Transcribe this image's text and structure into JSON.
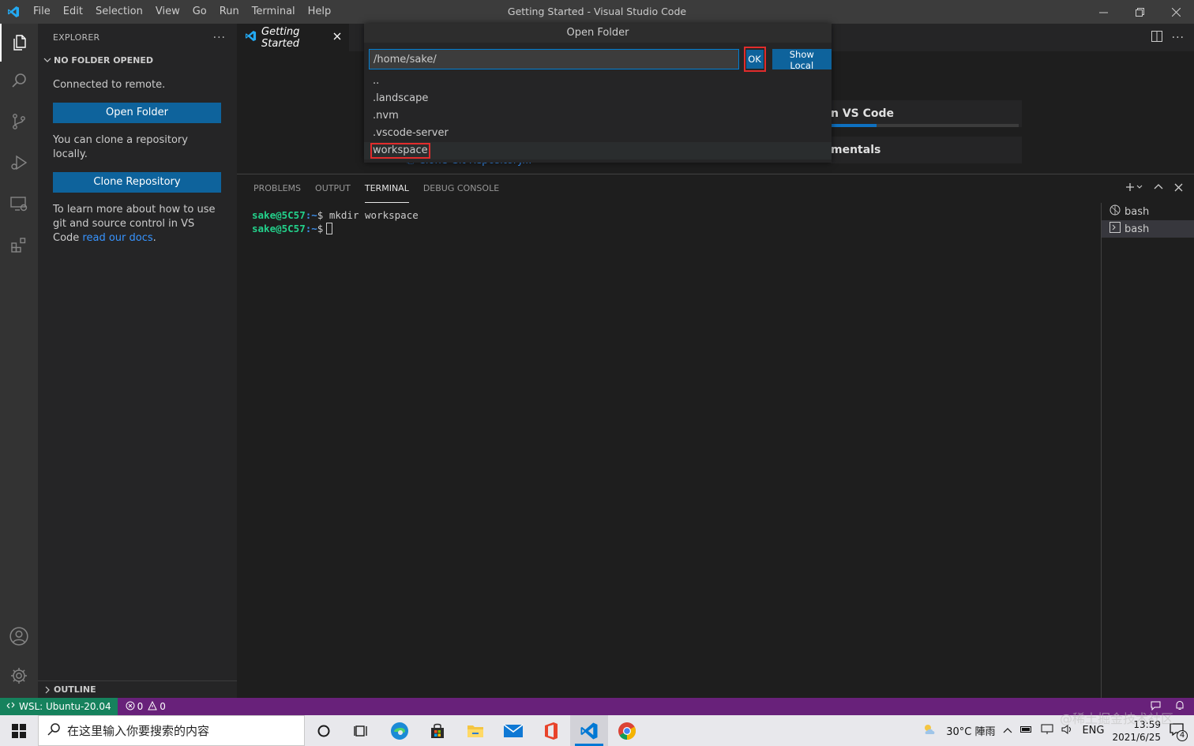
{
  "titlebar": {
    "title": "Getting Started - Visual Studio Code",
    "menu": [
      "File",
      "Edit",
      "Selection",
      "View",
      "Go",
      "Run",
      "Terminal",
      "Help"
    ]
  },
  "sidebar": {
    "header": "EXPLORER",
    "section": "NO FOLDER OPENED",
    "connected": "Connected to remote.",
    "open_folder": "Open Folder",
    "clone_text": "You can clone a repository locally.",
    "clone_button": "Clone Repository",
    "learn_text": "To learn more about how to use git and source control in VS Code ",
    "learn_link": "read our docs",
    "learn_end": ".",
    "outline": "OUTLINE"
  },
  "editor": {
    "tab": "Getting Started",
    "card1": "n VS Code",
    "card2": "mentals",
    "ghost_link": "Clone Git Repository...",
    "progress": 0.25
  },
  "quickinput": {
    "title": "Open Folder",
    "value": "/home/sake/",
    "ok": "OK",
    "show_local": "Show Local",
    "items": [
      "..",
      ".landscape",
      ".nvm",
      ".vscode-server",
      "workspace"
    ]
  },
  "panel": {
    "tabs": [
      "PROBLEMS",
      "OUTPUT",
      "TERMINAL",
      "DEBUG CONSOLE"
    ],
    "prompt_user": "sake@5C57",
    "prompt_path": ":~",
    "prompt_sym": "$",
    "command1": "mkdir workspace",
    "terminals": [
      "bash",
      "bash"
    ]
  },
  "statusbar": {
    "remote": "WSL: Ubuntu-20.04",
    "errors": "0",
    "warnings": "0"
  },
  "taskbar": {
    "search_placeholder": "在这里输入你要搜索的内容",
    "weather": "30°C 陣雨",
    "lang": "ENG",
    "time": "13:59",
    "date": "2021/6/25",
    "notif": "4"
  },
  "watermark": "@稀土掘金技术社区",
  "colors": {
    "accent": "#0e639c",
    "statusbar": "#68217a",
    "remote": "#16825d",
    "highlight": "#e12c2c"
  }
}
